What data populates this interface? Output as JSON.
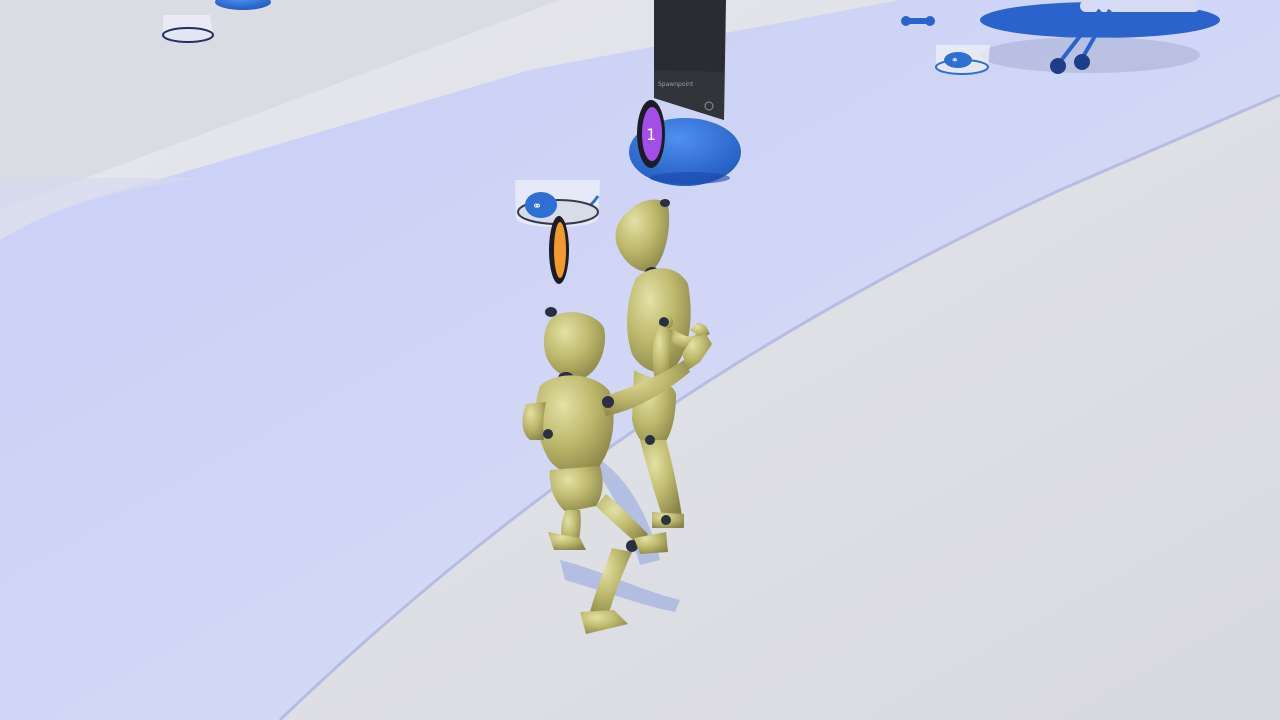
{
  "scene": {
    "palette": {
      "floor": "#cdd4f6",
      "ground": "#dcdde4",
      "accent_blue": "#2d6fd3",
      "dummy_olive": "#b8b469",
      "dummy_joint": "#2a2f44",
      "panel_dark": "#2b2c32"
    },
    "markers": [
      {
        "name": "player-1-marker",
        "label": "1",
        "color": "#a44ee8",
        "icon": "player-number-ring"
      },
      {
        "name": "player-2-marker",
        "label": "",
        "color": "#f29a2e",
        "icon": "player-ring"
      }
    ],
    "panel": {
      "label": "Spawnpoint"
    },
    "pads": [
      {
        "name": "dumbbell-pad-icon",
        "icon": "dumbbell-icon"
      },
      {
        "name": "dumbbell-pad-icon-back",
        "icon": "dumbbell-icon"
      }
    ]
  }
}
